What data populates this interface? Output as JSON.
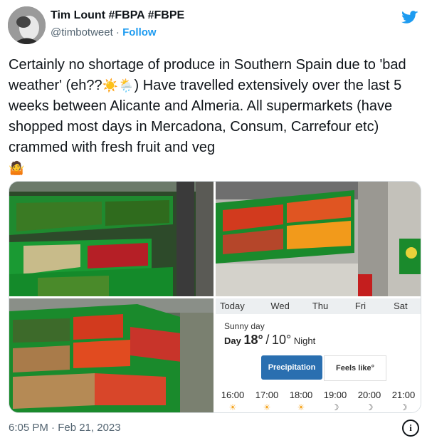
{
  "author": {
    "name": "Tim Lount #FBPA #FBPE",
    "handle": "@timbotweet",
    "separator": " · ",
    "follow_label": "Follow"
  },
  "tweet": {
    "text_part1": "Certainly no shortage of produce in Southern Spain due to 'bad weather' (eh??",
    "emoji_sun": "☀️",
    "emoji_cloud_rain": "🌦️",
    "text_part2": ") Have travelled extensively over the last 5 weeks between Alicante and Almeria. All supermarkets (have shopped most days in Mercadona, Consum, Carrefour etc) crammed with fresh fruit and veg",
    "emoji_person": "🤷"
  },
  "weather": {
    "days": [
      "Today",
      "Wed",
      "Thu",
      "Fri",
      "Sat"
    ],
    "condition": "Sunny day",
    "day_label": "Day",
    "high": "18°",
    "separator": "/",
    "low": "10°",
    "night_label": "Night",
    "tab_active": "Precipitation",
    "tab_inactive": "Feels like°",
    "hours": [
      "16:00",
      "17:00",
      "18:00",
      "19:00",
      "20:00",
      "21:00"
    ]
  },
  "timestamp": "6:05 PM · Feb 21, 2023",
  "icons": {
    "info": "info-icon",
    "bird": "twitter-bird-icon"
  },
  "colors": {
    "follow": "#1d9bf0",
    "precip_tab": "#2a6fb0"
  }
}
